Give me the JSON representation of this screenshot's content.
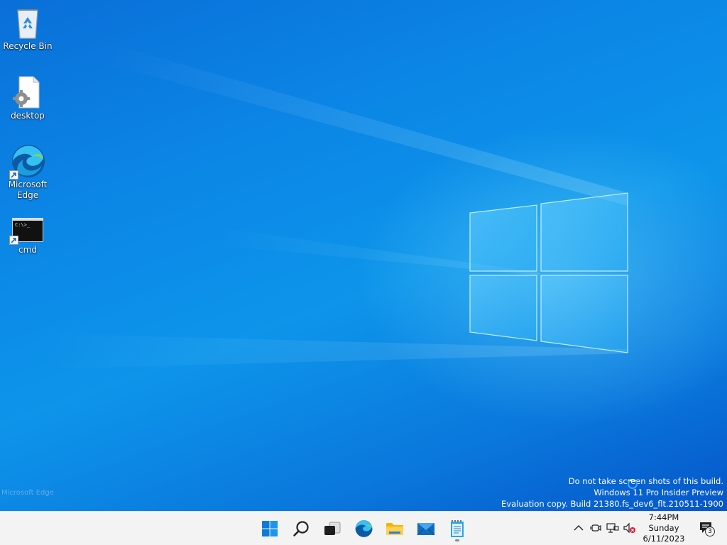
{
  "desktop": {
    "icons": [
      {
        "label": "Recycle Bin",
        "icon": "recycle-bin-icon"
      },
      {
        "label": "desktop",
        "icon": "settings-file-icon"
      },
      {
        "label": "Microsoft Edge",
        "icon": "edge-icon"
      },
      {
        "label": "cmd",
        "icon": "cmd-icon"
      }
    ],
    "cmd_prompt": "C:\\>_",
    "left_label": "Microsoft Edge",
    "watermark": {
      "line1": "Do not take screen shots of this build.",
      "line2": "Windows 11 Pro Insider Preview",
      "line3": "Evaluation copy. Build 21380.fs_dev6_flt.210511-1900"
    }
  },
  "taskbar": {
    "pinned": [
      {
        "name": "Start",
        "icon": "windows-start-icon"
      },
      {
        "name": "Search",
        "icon": "search-icon"
      },
      {
        "name": "Task View",
        "icon": "task-view-icon"
      },
      {
        "name": "Microsoft Edge",
        "icon": "edge-icon"
      },
      {
        "name": "File Explorer",
        "icon": "folder-icon"
      },
      {
        "name": "Mail",
        "icon": "mail-icon"
      },
      {
        "name": "Notepad",
        "icon": "notepad-icon"
      }
    ],
    "tray": {
      "icons": [
        "chevron-up-icon",
        "meet-now-icon",
        "network-icon",
        "volume-muted-icon"
      ],
      "time": "7:44PM",
      "day": "Sunday",
      "date": "6/11/2023",
      "notification_count": "3"
    }
  },
  "colors": {
    "desktop_blue": "#0b86e6",
    "taskbar_bg": "#f3f3f3",
    "accent": "#0078d4"
  }
}
